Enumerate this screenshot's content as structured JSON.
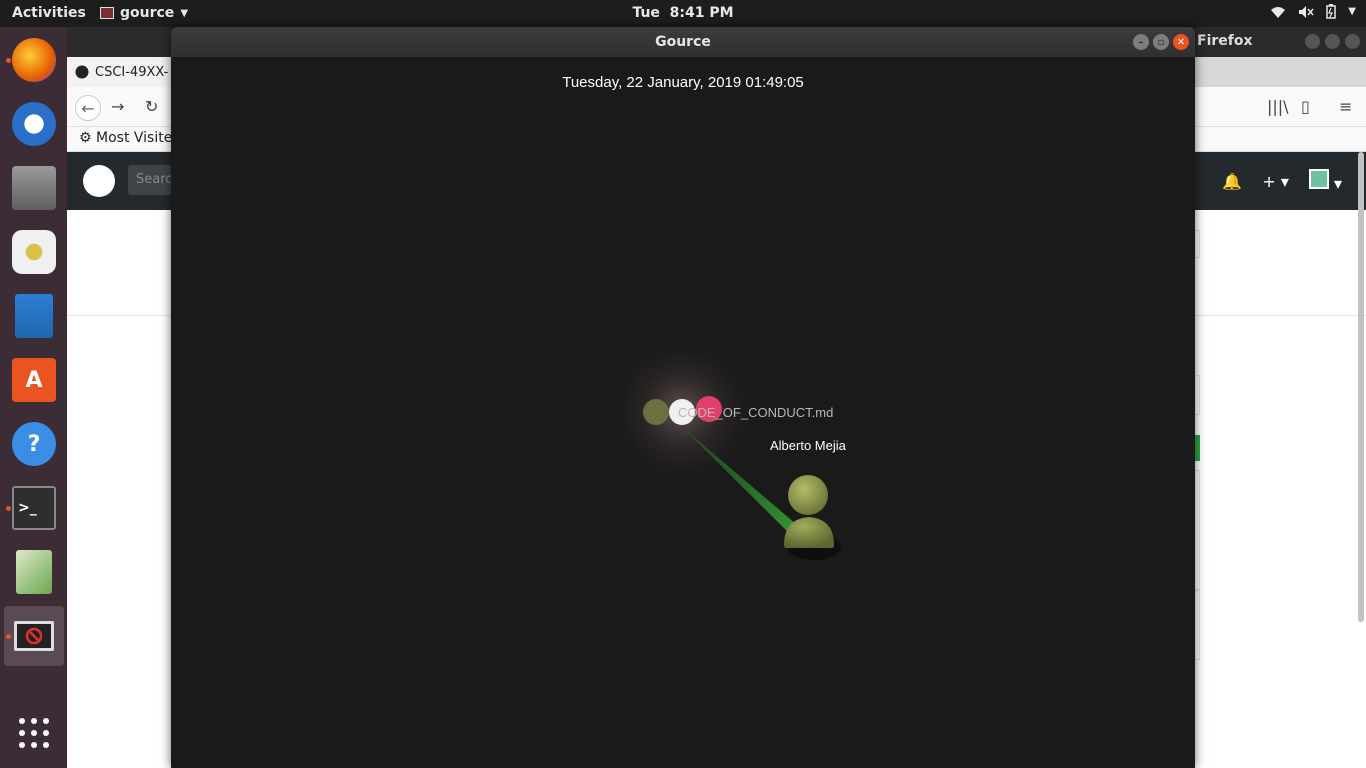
{
  "topbar": {
    "activities": "Activities",
    "app_name": "gource",
    "clock_day": "Tue",
    "clock_time": "8:41 PM"
  },
  "dock": {
    "items": [
      {
        "name": "firefox",
        "icon": "firefox-icon",
        "color": "#e66000",
        "running": true
      },
      {
        "name": "thunderbird",
        "icon": "thunderbird-icon",
        "color": "#2a6fc9",
        "running": false
      },
      {
        "name": "files",
        "icon": "files-icon",
        "color": "#7a7a7a",
        "running": false
      },
      {
        "name": "rhythmbox",
        "icon": "rhythmbox-icon",
        "color": "#d9c14a",
        "running": false
      },
      {
        "name": "libreoffice-writer",
        "icon": "writer-icon",
        "color": "#1e66b0",
        "running": false
      },
      {
        "name": "software",
        "icon": "software-center-icon",
        "color": "#e95420",
        "running": false
      },
      {
        "name": "help",
        "icon": "help-icon",
        "color": "#3a8ee6",
        "running": false
      },
      {
        "name": "terminal",
        "icon": "terminal-icon",
        "color": "#2e2e2e",
        "running": true
      },
      {
        "name": "text-editor",
        "icon": "gedit-icon",
        "color": "#6aa84f",
        "running": false
      },
      {
        "name": "gource",
        "icon": "gource-app-icon",
        "color": "#c0392b",
        "running": true
      }
    ],
    "show_apps_icon": "grid-icon"
  },
  "firefox": {
    "window_title": "Firefox",
    "tab_title": "CSCI-49XX-",
    "bookmarks_label": "Most Visite",
    "search_placeholder": "Searc"
  },
  "gource": {
    "window_title": "Gource",
    "date_text": "Tuesday, 22 January, 2019 01:49:05",
    "file_name": "CODE_OF_CONDUCT.md",
    "user_name": "Alberto Mejia",
    "colors": {
      "background": "#1a1a1a",
      "beam": "#2e8b2e",
      "user": "#8f9a4a",
      "file_dim": "#6b7040",
      "file_white": "#f0f0f0",
      "file_pink": "#e0406a"
    }
  }
}
